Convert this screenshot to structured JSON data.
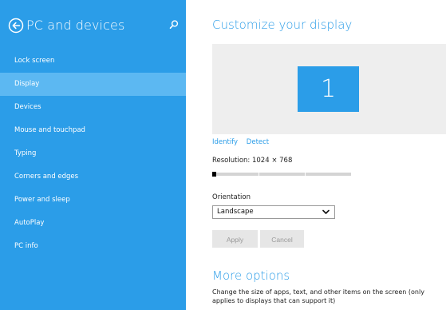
{
  "sidebar": {
    "title": "PC and devices",
    "back_icon": "back-arrow-circle-icon",
    "search_icon": "search-icon",
    "bg_color": "#2B9DE8",
    "selected_color": "#5CB8F2",
    "items": [
      {
        "label": "Lock screen",
        "selected": false
      },
      {
        "label": "Display",
        "selected": true
      },
      {
        "label": "Devices",
        "selected": false
      },
      {
        "label": "Mouse and touchpad",
        "selected": false
      },
      {
        "label": "Typing",
        "selected": false
      },
      {
        "label": "Corners and edges",
        "selected": false
      },
      {
        "label": "Power and sleep",
        "selected": false
      },
      {
        "label": "AutoPlay",
        "selected": false
      },
      {
        "label": "PC info",
        "selected": false
      }
    ]
  },
  "main": {
    "title": "Customize your display",
    "monitor_number": "1",
    "identify_link": "Identify",
    "detect_link": "Detect",
    "resolution_label": "Resolution: 1024 × 768",
    "resolution_slider_value": 0,
    "orientation_label": "Orientation",
    "orientation_value": "Landscape",
    "apply_label": "Apply",
    "cancel_label": "Cancel",
    "more_options_title": "More options",
    "more_options_desc": "Change the size of apps, text, and other items on the screen (only applies to displays that can support it)",
    "accent_color": "#2B9DE8"
  }
}
